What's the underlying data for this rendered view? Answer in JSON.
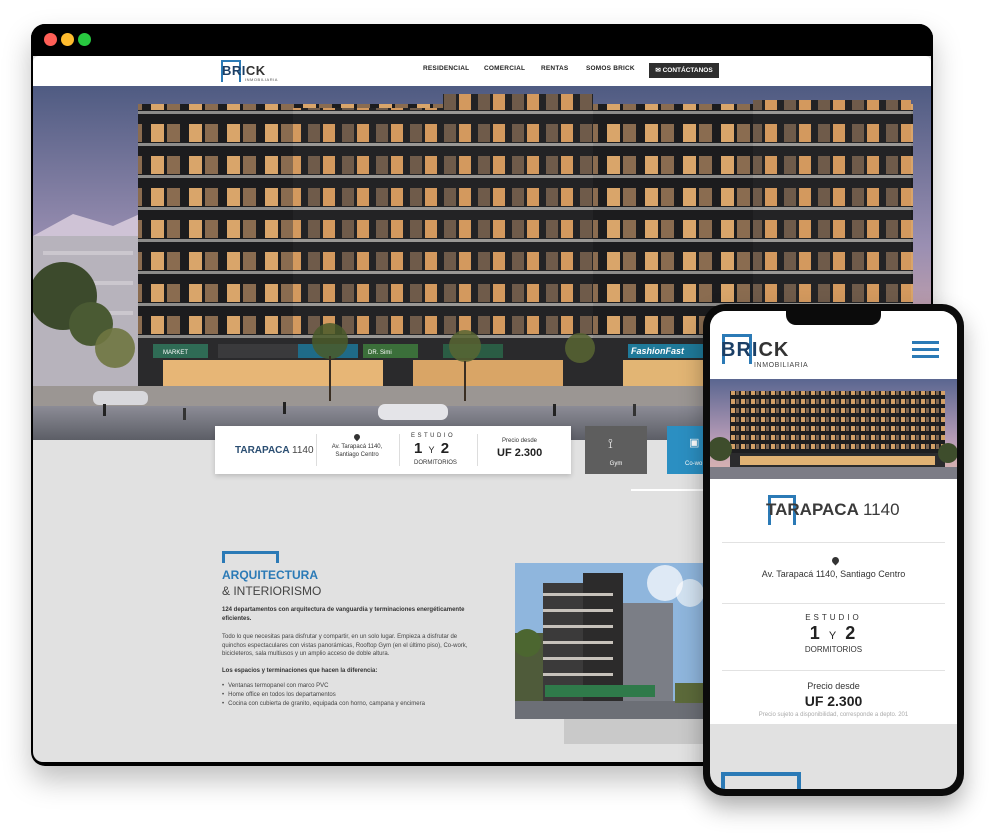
{
  "desktop": {
    "window_controls": [
      "close",
      "minimize",
      "maximize"
    ],
    "header": {
      "logo": {
        "word_left": "BRI",
        "word_right": "CK",
        "sub": "INMOBILIARIA"
      },
      "nav": [
        "RESIDENCIAL",
        "COMERCIAL",
        "RENTAS",
        "SOMOS BRICK"
      ],
      "cta": "✉ CONTÁCTANOS"
    },
    "hero": {
      "signs": [
        "MARKET",
        "DR. Simi",
        "FashionFast"
      ]
    },
    "info": {
      "project_name": "TARAPACA",
      "project_number": "1140",
      "address_line1": "Av. Tarapacá 1140,",
      "address_line2": "Santiago Centro",
      "estudio": "ESTUDIO",
      "beds_a": "1",
      "beds_y": "Y",
      "beds_b": "2",
      "dormitorios": "DORMITORIOS",
      "price_label": "Precio desde",
      "price": "UF 2.300"
    },
    "amenities": [
      {
        "label": "Gym",
        "icon": "dumbbell-icon"
      },
      {
        "label": "Co-wo",
        "icon": "cowork-icon"
      }
    ],
    "architecture": {
      "title": "ARQUITECTURA",
      "subtitle": "& INTERIORISMO",
      "lead": "124 departamentos con arquitectura de vanguardia y terminaciones energéticamente eficientes.",
      "body": "Todo lo que necesitas para disfrutar y compartir, en un solo lugar. Empieza a disfrutar de quinchos espectaculares con vistas panorámicas, Rooftop Gym (en el último piso), Co-work, bicicleteros, sala multiusos y un amplio acceso de doble altura.",
      "list_title": "Los espacios y terminaciones que hacen la diferencia:",
      "list": [
        "Ventanas termopanel con marco PVC",
        "Home office en todos los departamentos",
        "Cocina con cubierta de granito, equipada con horno, campana y encimera"
      ]
    }
  },
  "mobile": {
    "logo": {
      "word_left": "BRI",
      "word_right": "CK",
      "sub": "INMOBILIARIA"
    },
    "menu_icon": "hamburger-icon",
    "project_name": "TARAPACA",
    "project_number": "1140",
    "address": "Av. Tarapacá 1140, Santiago Centro",
    "estudio": "ESTUDIO",
    "beds_a": "1",
    "beds_y": "Y",
    "beds_b": "2",
    "dormitorios": "DORMITORIOS",
    "price_label": "Precio desde",
    "price": "UF 2.300",
    "price_note": "Precio sujeto a disponibilidad, corresponde a depto. 201"
  },
  "colors": {
    "brand_blue": "#2b7ab6",
    "brand_navy": "#1b3f66",
    "gym_tile": "#5e5e5e",
    "cowork_tile": "#2b8fc2"
  }
}
